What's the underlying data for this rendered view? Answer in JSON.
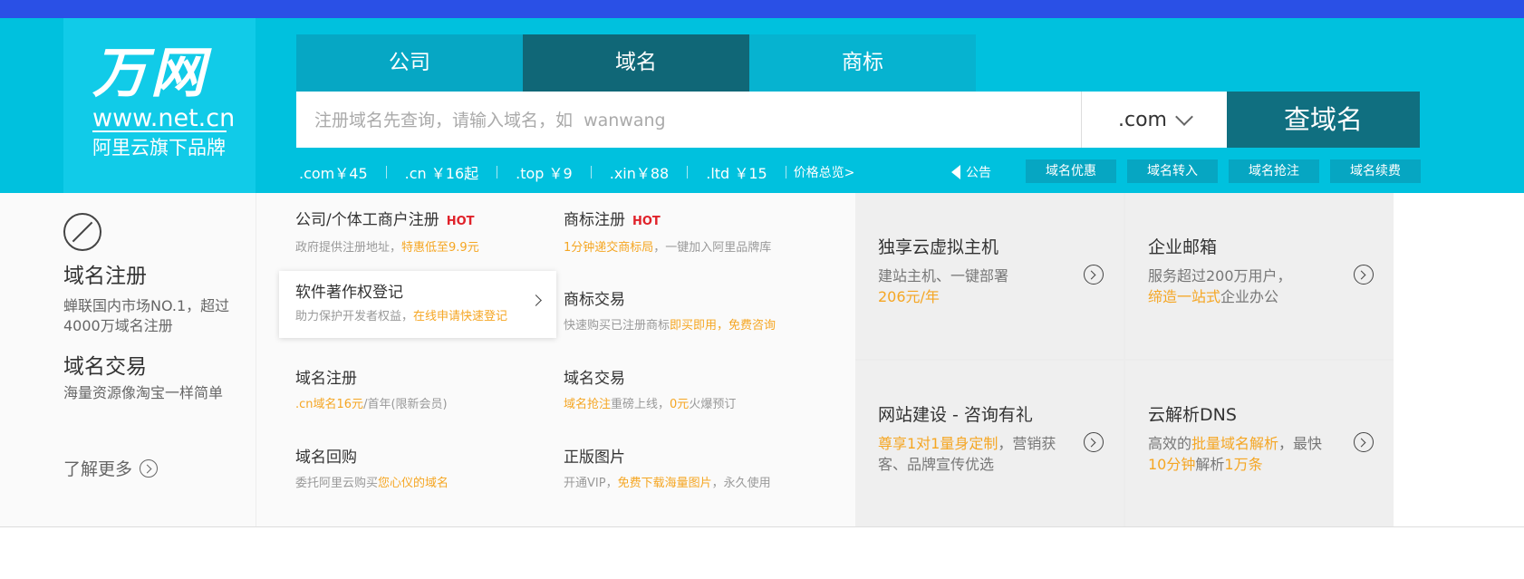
{
  "logo": {
    "main": "万网",
    "url": "www.net.cn",
    "sub": "阿里云旗下品牌"
  },
  "tabs": [
    {
      "label": "公司",
      "active": false
    },
    {
      "label": "域名",
      "active": true
    },
    {
      "label": "商标",
      "active": false
    }
  ],
  "search": {
    "placeholder": "注册域名先查询，请输入域名，如  wanwang",
    "suffix": ".com",
    "button": "查域名"
  },
  "prices": [
    {
      "tld": ".com",
      "price": "￥45"
    },
    {
      "tld": ".cn",
      "price": "￥16起"
    },
    {
      "tld": ".top",
      "price": "￥9"
    },
    {
      "tld": ".xin",
      "price": "￥88"
    },
    {
      "tld": ".ltd",
      "price": "￥15"
    }
  ],
  "price_all": "价格总览>",
  "notice": "公告",
  "quick_buttons": [
    "域名优惠",
    "域名转入",
    "域名抢注",
    "域名续费"
  ],
  "left": {
    "title1": "域名注册",
    "desc1": "蝉联国内市场NO.1，超过4000万域名注册",
    "title2": "域名交易",
    "desc2": "海量资源像淘宝一样简单",
    "more": "了解更多"
  },
  "services": [
    {
      "title": "公司/个体工商户注册",
      "hot": "HOT",
      "desc_a": "政府提供注册地址，",
      "desc_b": "特惠低至9.9元",
      "desc_c": ""
    },
    {
      "title": "商标注册",
      "hot": "HOT",
      "desc_a": "",
      "desc_b": "1分钟递交商标局",
      "desc_c": "，一键加入阿里品牌库"
    },
    {
      "title": "软件著作权登记",
      "hot": "",
      "desc_a": "助力保护开发者权益，",
      "desc_b": "在线申请快速登记",
      "desc_c": ""
    },
    {
      "title": "商标交易",
      "hot": "",
      "desc_a": "快速购买已注册商标",
      "desc_b": "即买即用，免费咨询",
      "desc_c": ""
    },
    {
      "title": "域名注册",
      "hot": "",
      "desc_a": "",
      "desc_b": ".cn域名16元",
      "desc_c": "/首年(限新会员)"
    },
    {
      "title": "域名交易",
      "hot": "",
      "desc_a": "",
      "desc_b": "域名抢注",
      "desc_c": "重磅上线，",
      "desc_d": "0元",
      "desc_e": "火爆预订"
    },
    {
      "title": "域名回购",
      "hot": "",
      "desc_a": "委托阿里云购买",
      "desc_b": "您心仪的域名",
      "desc_c": ""
    },
    {
      "title": "正版图片",
      "hot": "",
      "desc_a": "开通VIP，",
      "desc_b": "免费下载海量图片",
      "desc_c": "，永久使用"
    }
  ],
  "promos": [
    {
      "title": "独享云虚拟主机",
      "desc_a": "建站主机、一键部署",
      "desc_b": "206元/年",
      "desc_c": ""
    },
    {
      "title": "企业邮箱",
      "desc_a": "服务超过200万用户，",
      "desc_b": "缔造一站式",
      "desc_c": "企业办公"
    },
    {
      "title": "网站建设 - 咨询有礼",
      "desc_a": "",
      "desc_b": "尊享1对1量身定制",
      "desc_c": "，营销获客、品牌宣传优选"
    },
    {
      "title": "云解析DNS",
      "desc_a": "高效的",
      "desc_b": "批量域名解析",
      "desc_c": "，最快 ",
      "desc_d": "10分钟",
      "desc_e": "解析",
      "desc_f": "1万条"
    }
  ]
}
